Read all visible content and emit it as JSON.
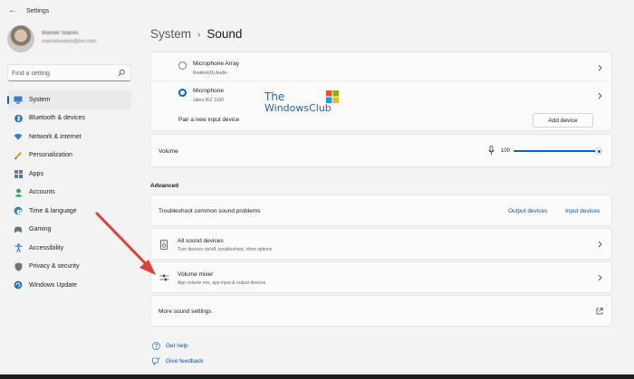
{
  "window": {
    "title": "Settings"
  },
  "profile": {
    "name": "Manoel Soares",
    "email": "manoelsoares@live.com"
  },
  "search": {
    "placeholder": "Find a setting"
  },
  "sidebar": {
    "items": [
      {
        "label": "System",
        "icon": "monitor-icon",
        "active": true
      },
      {
        "label": "Bluetooth & devices",
        "icon": "bluetooth-icon"
      },
      {
        "label": "Network & internet",
        "icon": "wifi-icon"
      },
      {
        "label": "Personalization",
        "icon": "brush-icon"
      },
      {
        "label": "Apps",
        "icon": "apps-icon"
      },
      {
        "label": "Accounts",
        "icon": "person-icon"
      },
      {
        "label": "Time & language",
        "icon": "globe-clock-icon"
      },
      {
        "label": "Gaming",
        "icon": "gamepad-icon"
      },
      {
        "label": "Accessibility",
        "icon": "accessibility-icon"
      },
      {
        "label": "Privacy & security",
        "icon": "shield-icon"
      },
      {
        "label": "Windows Update",
        "icon": "update-icon"
      }
    ]
  },
  "header": {
    "breadcrumb": "System",
    "title": "Sound"
  },
  "input_devices": [
    {
      "name": "Microphone Array",
      "subtitle": "Realtek(R) Audio",
      "selected": false
    },
    {
      "name": "Microphone",
      "subtitle": "Jabra BIZ 1100",
      "selected": true
    }
  ],
  "pair": {
    "label": "Pair a new input device",
    "button": "Add device"
  },
  "volume": {
    "label": "Volume",
    "value": "100",
    "level": 1.0
  },
  "advanced": {
    "label": "Advanced",
    "troubleshoot": {
      "label": "Troubleshoot common sound problems",
      "link_output": "Output devices",
      "link_input": "Input devices"
    },
    "all_devices": {
      "title": "All sound devices",
      "subtitle": "Turn devices on/off, troubleshoot, other options"
    },
    "mixer": {
      "title": "Volume mixer",
      "subtitle": "App volume mix, app input & output devices"
    },
    "more": {
      "label": "More sound settings"
    }
  },
  "footer": {
    "help": "Get help",
    "feedback": "Give feedback"
  },
  "watermark": {
    "line1": "The",
    "line2": "WindowsClub"
  },
  "colors": {
    "accent": "#0067c0",
    "link": "#0057a8",
    "arrow": "#e0403a"
  }
}
